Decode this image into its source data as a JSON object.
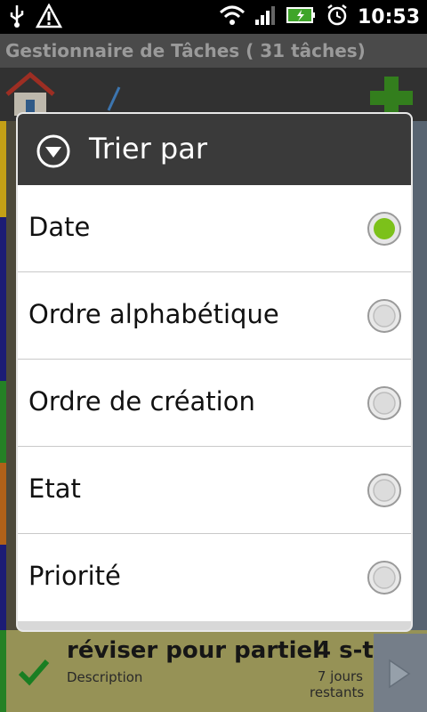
{
  "status_bar": {
    "time": "10:53"
  },
  "app": {
    "title": "Gestionnaire de Tâches ( 31 tâches)"
  },
  "dialog": {
    "title": "Trier par",
    "options": [
      {
        "label": "Date",
        "selected": true
      },
      {
        "label": "Ordre alphabétique",
        "selected": false
      },
      {
        "label": "Ordre de création",
        "selected": false
      },
      {
        "label": "Etat",
        "selected": false
      },
      {
        "label": "Priorité",
        "selected": false
      }
    ]
  },
  "visible_task": {
    "title": "réviser pour partiel",
    "description": "Description",
    "badge": "4 s-t",
    "days_line1": "7 jours",
    "days_line2": "restants"
  },
  "colors": {
    "selected_radio": "#7cc11a",
    "dialog_header": "#3a3a3a"
  }
}
